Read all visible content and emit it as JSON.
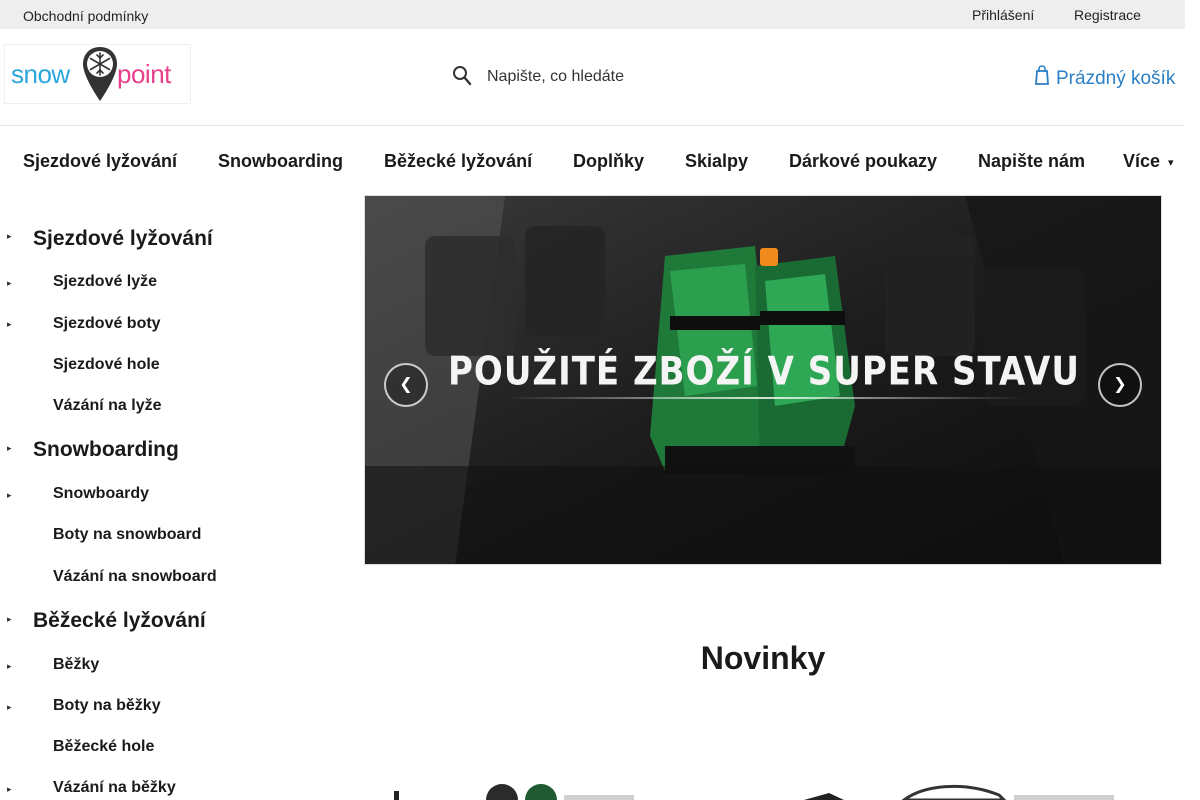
{
  "topbar": {
    "terms": "Obchodní podmínky",
    "login": "Přihlášení",
    "register": "Registrace"
  },
  "header": {
    "logo_left": "snow",
    "logo_right": "point",
    "search_placeholder": "Napište, co hledáte",
    "search_icon": "search-icon",
    "cart_label": "Prázdný košík",
    "cart_icon": "cart-icon"
  },
  "nav": {
    "items": [
      "Sjezdové lyžování",
      "Snowboarding",
      "Běžecké lyžování",
      "Doplňky",
      "Skialpy",
      "Dárkové poukazy",
      "Napište nám",
      "Více"
    ]
  },
  "sidebar": {
    "categories": [
      {
        "label": "Sjezdové lyžování",
        "items": [
          "Sjezdové lyže",
          "Sjezdové boty",
          "Sjezdové hole",
          "Vázání na lyže"
        ]
      },
      {
        "label": "Snowboarding",
        "items": [
          "Snowboardy",
          "Boty na snowboard",
          "Vázání na snowboard"
        ]
      },
      {
        "label": "Běžecké lyžování",
        "items": [
          "Běžky",
          "Boty na běžky",
          "Běžecké hole",
          "Vázání na běžky"
        ]
      }
    ]
  },
  "banner": {
    "caption": "POUŽITÉ ZBOŽÍ V SUPER STAVU",
    "prev_icon": "chevron-left-icon",
    "next_icon": "chevron-right-icon"
  },
  "novinky": {
    "title": "Novinky"
  },
  "colors": {
    "topbar_bg": "#eeeeee",
    "logo_blue": "#2aa7df",
    "logo_pink": "#e8408a",
    "cart_blue": "#2b7fc4"
  }
}
